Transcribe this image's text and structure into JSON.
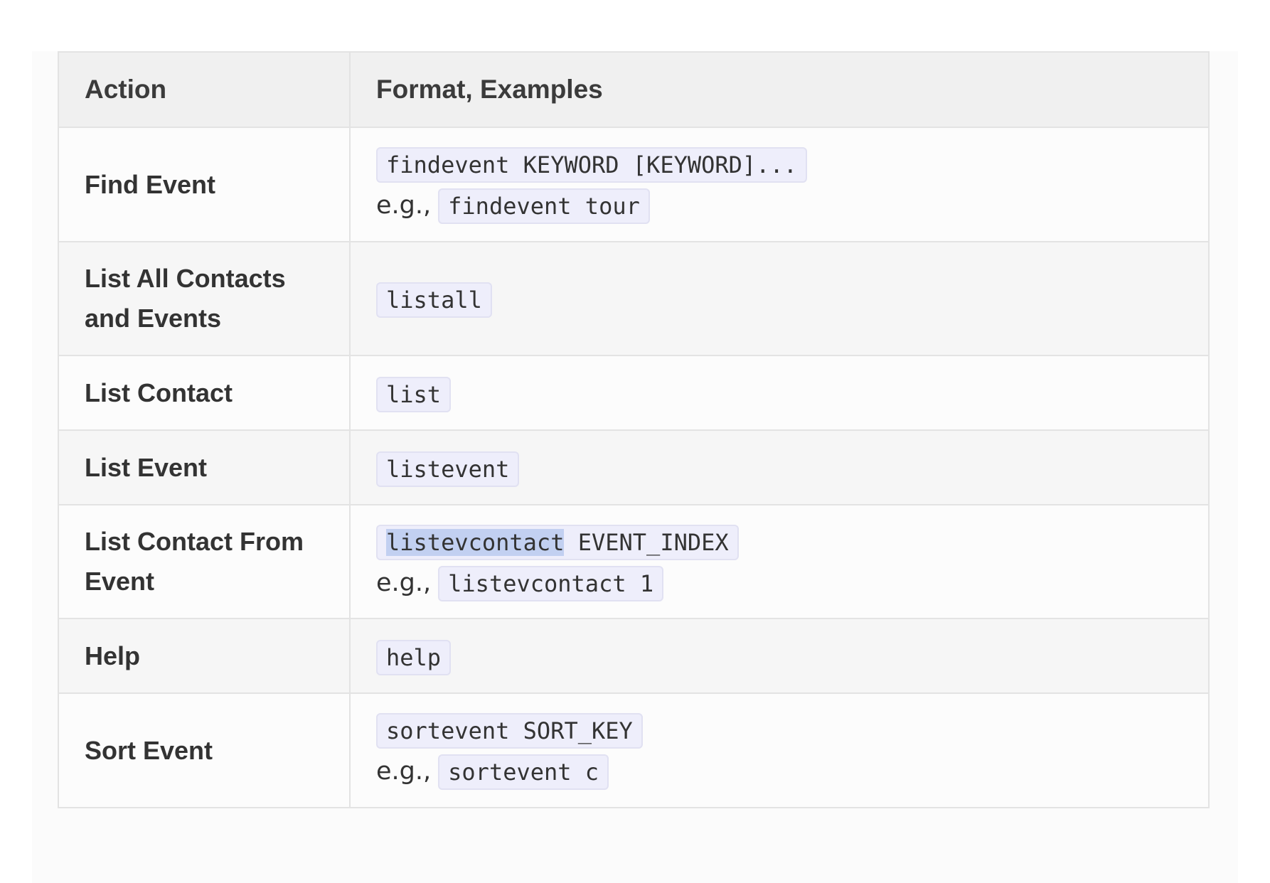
{
  "table": {
    "headers": [
      "Action",
      "Format, Examples"
    ],
    "eg_label": "e.g.,",
    "rows": [
      {
        "action": "Find Event",
        "format": "findevent KEYWORD [KEYWORD]...",
        "example": "findevent tour"
      },
      {
        "action": "List All Contacts and Events",
        "format": "listall"
      },
      {
        "action": "List Contact",
        "format": "list"
      },
      {
        "action": "List Event",
        "format": "listevent"
      },
      {
        "action": "List Contact From Event",
        "format_selected": "listevcontact",
        "format_rest": " EVENT_INDEX",
        "example": "listevcontact 1"
      },
      {
        "action": "Help",
        "format": "help"
      },
      {
        "action": "Sort Event",
        "format": "sortevent SORT_KEY",
        "example": "sortevent c"
      }
    ]
  },
  "colors": {
    "code_background": "#eeeefb",
    "selection_highlight": "#c2d0f1",
    "header_background": "#f0f0f0"
  }
}
